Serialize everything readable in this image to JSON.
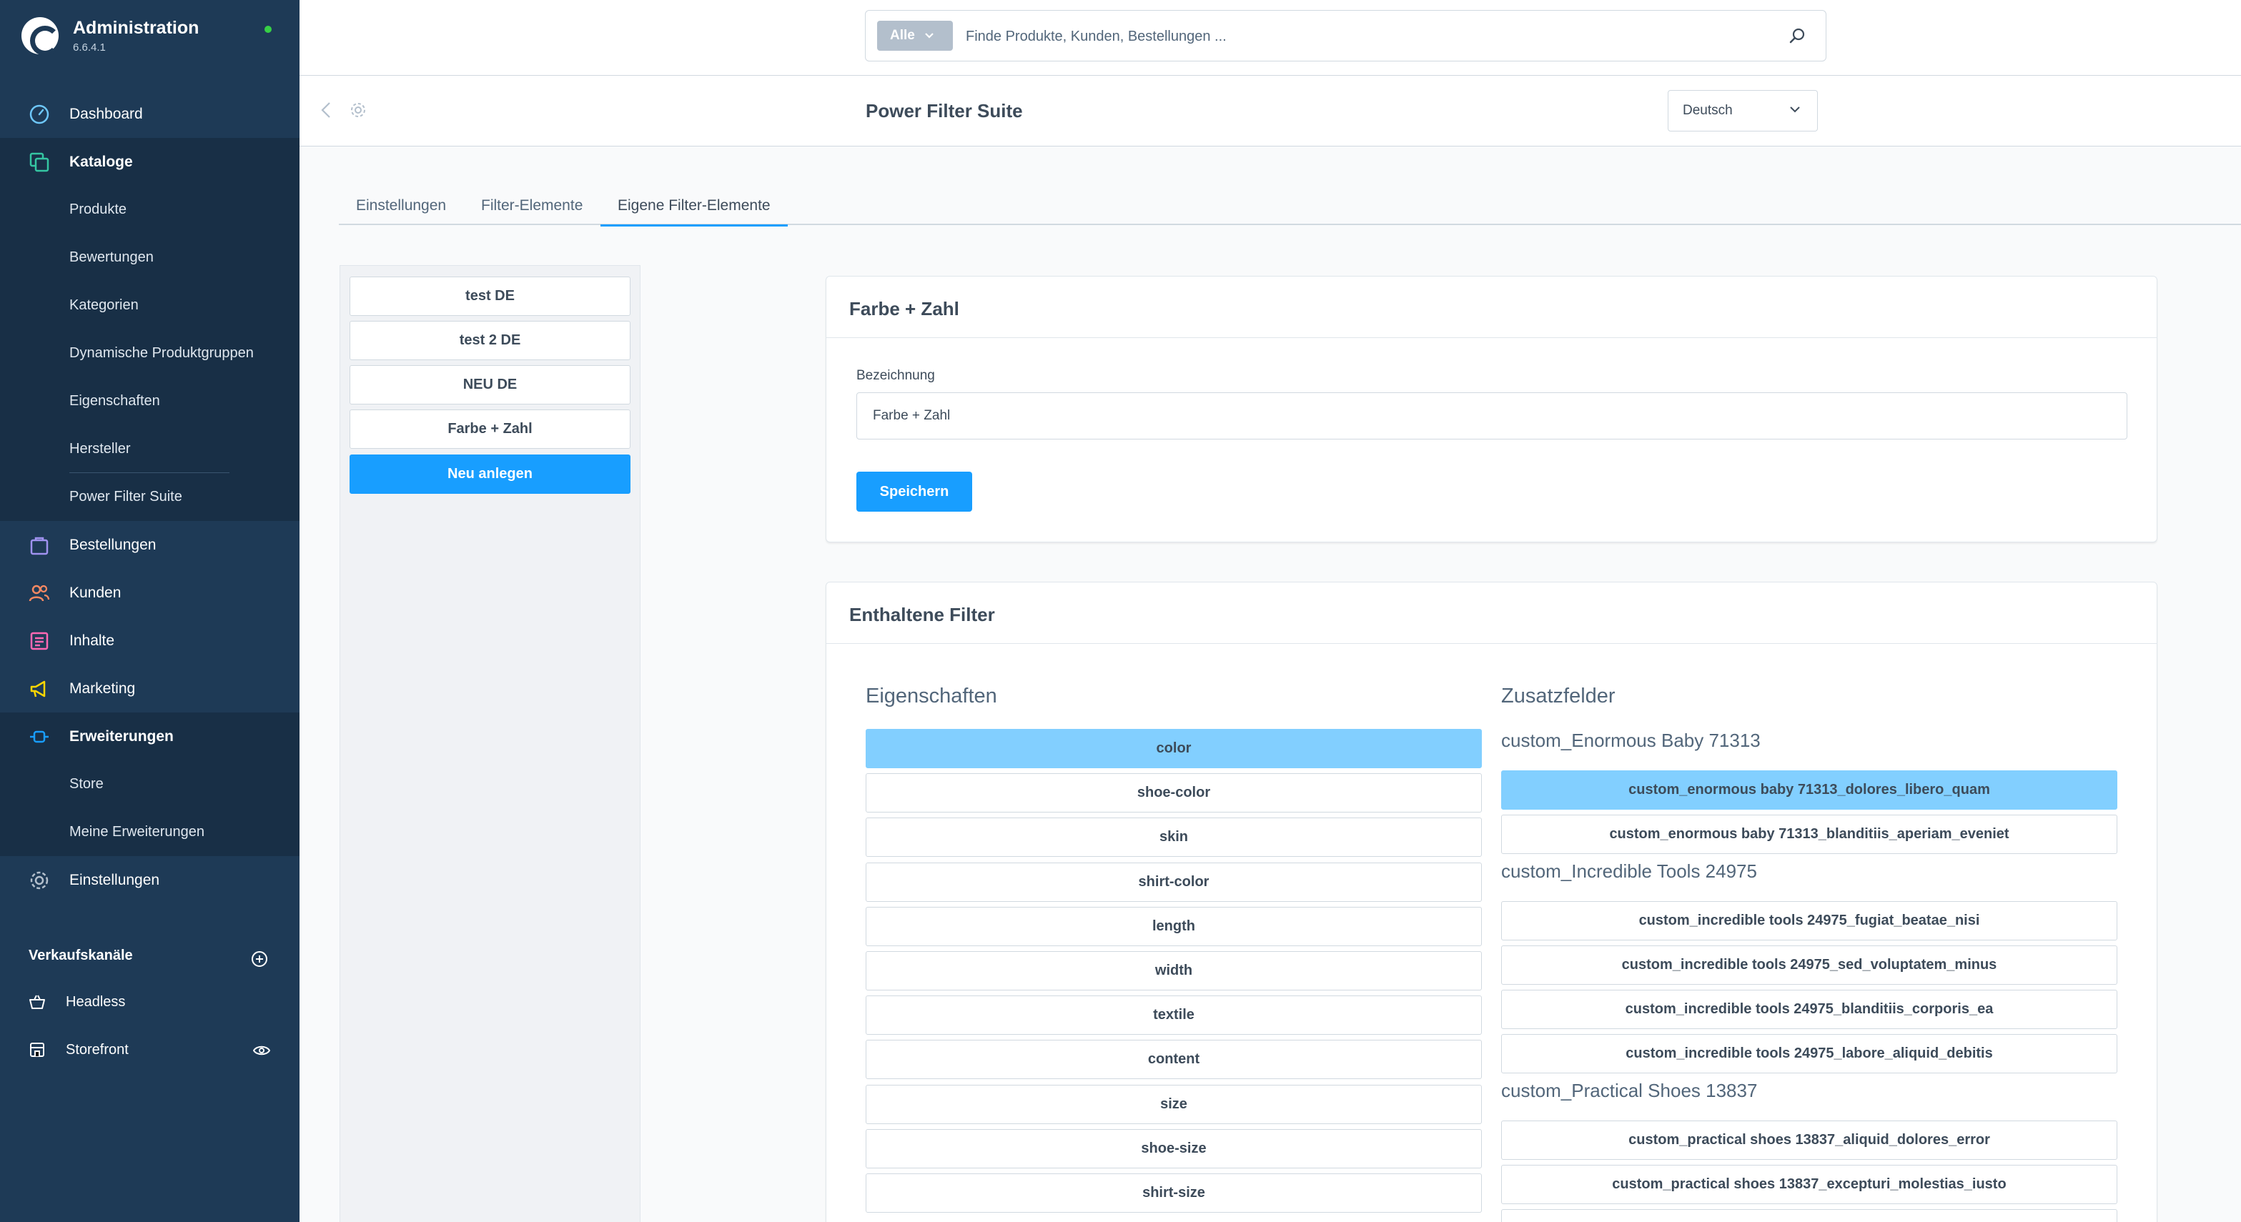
{
  "colors": {
    "sidebar": "#1e3a56",
    "accent": "#189eff",
    "selected": "#82cfff",
    "online": "#37d046"
  },
  "app": {
    "name": "Administration",
    "version": "6.6.4.1"
  },
  "nav": {
    "dashboard": "Dashboard",
    "kataloge": "Kataloge",
    "produkte": "Produkte",
    "bewertungen": "Bewertungen",
    "kategorien": "Kategorien",
    "dynamische": "Dynamische Produktgruppen",
    "eigenschaften": "Eigenschaften",
    "hersteller": "Hersteller",
    "powerfilter": "Power Filter Suite",
    "bestellungen": "Bestellungen",
    "kunden": "Kunden",
    "inhalte": "Inhalte",
    "marketing": "Marketing",
    "erweiterungen": "Erweiterungen",
    "store": "Store",
    "meine": "Meine Erweiterungen",
    "einstellungen": "Einstellungen"
  },
  "saleschannels": {
    "label": "Verkaufskanäle",
    "headless": "Headless",
    "storefront": "Storefront"
  },
  "search": {
    "type": "Alle",
    "placeholder": "Finde Produkte, Kunden, Bestellungen ..."
  },
  "header": {
    "title": "Power Filter Suite",
    "language": "Deutsch"
  },
  "tabs": {
    "einstellungen": "Einstellungen",
    "filter": "Filter-Elemente",
    "eigene": "Eigene Filter-Elemente"
  },
  "sets": {
    "s1": "test DE",
    "s2": "test 2 DE",
    "s3": "NEU DE",
    "s4": "Farbe + Zahl",
    "create": "Neu anlegen"
  },
  "detail": {
    "title": "Farbe + Zahl",
    "label": "Bezeichnung",
    "value": "Farbe + Zahl",
    "save": "Speichern"
  },
  "filters": {
    "title": "Enthaltene Filter",
    "properties_heading": "Eigenschaften",
    "properties": [
      "color",
      "shoe-color",
      "skin",
      "shirt-color",
      "length",
      "width",
      "textile",
      "content",
      "size",
      "shoe-size",
      "shirt-size"
    ],
    "custom_heading": "Zusatzfelder",
    "g1": {
      "name": "custom_Enormous Baby 71313",
      "items": [
        "custom_enormous baby 71313_dolores_libero_quam",
        "custom_enormous baby 71313_blanditiis_aperiam_eveniet"
      ]
    },
    "g2": {
      "name": "custom_Incredible Tools 24975",
      "items": [
        "custom_incredible tools 24975_fugiat_beatae_nisi",
        "custom_incredible tools 24975_sed_voluptatem_minus",
        "custom_incredible tools 24975_blanditiis_corporis_ea",
        "custom_incredible tools 24975_labore_aliquid_debitis"
      ]
    },
    "g3": {
      "name": "custom_Practical Shoes 13837",
      "items": [
        "custom_practical shoes 13837_aliquid_dolores_error",
        "custom_practical shoes 13837_excepturi_molestias_iusto"
      ]
    }
  }
}
